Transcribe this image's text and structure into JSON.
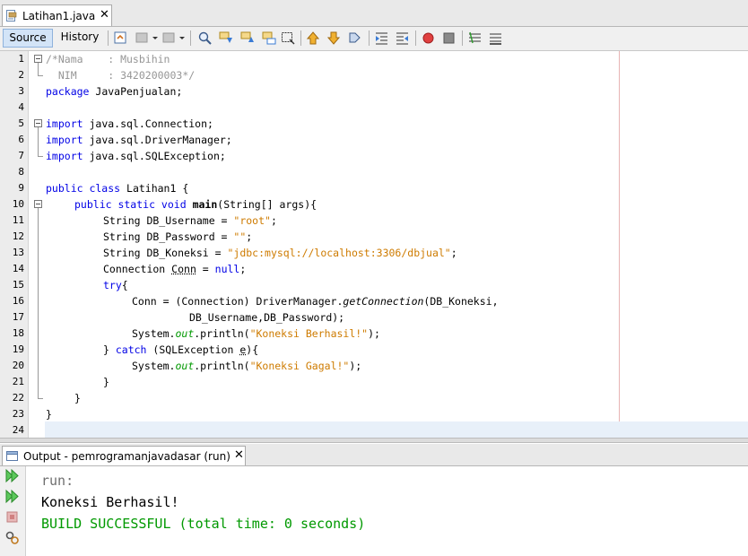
{
  "editor_tab": {
    "title": "Latihan1.java",
    "close": "✕"
  },
  "toolbar": {
    "source": "Source",
    "history": "History"
  },
  "line_numbers": [
    "1",
    "2",
    "3",
    "4",
    "5",
    "6",
    "7",
    "8",
    "9",
    "10",
    "11",
    "12",
    "13",
    "14",
    "15",
    "16",
    "17",
    "18",
    "19",
    "20",
    "21",
    "22",
    "23",
    "24"
  ],
  "code": {
    "l1": "/*Nama    : Musbihin",
    "l2": "  NIM     : 3420200003*/",
    "l3_kw": "package",
    "l3_rest": " JavaPenjualan;",
    "l5_kw": "import",
    "l5_rest": " java.sql.Connection;",
    "l6_kw": "import",
    "l6_rest": " java.sql.DriverManager;",
    "l7_kw": "import",
    "l7_rest": " java.sql.SQLException;",
    "l9_kw": "public class",
    "l9_name": " Latihan1",
    "l9_rest": " {",
    "l10_kw": "public static void",
    "l10_name": "main",
    "l10_rest": "(String[] args){",
    "l11_a": "String DB_Username = ",
    "l11_s": "\"root\"",
    "l11_b": ";",
    "l12_a": "String DB_Password = ",
    "l12_s": "\"\"",
    "l12_b": ";",
    "l13_a": "String DB_Koneksi = ",
    "l13_s": "\"jdbc:mysql://localhost:3306/dbjual\"",
    "l13_b": ";",
    "l14_a": "Connection ",
    "l14_u": "Conn",
    "l14_b": " = ",
    "l14_kw": "null",
    "l14_c": ";",
    "l15_kw": "try",
    "l15_b": "{",
    "l16_a": "Conn = (Connection) DriverManager.",
    "l16_i": "getConnection",
    "l16_b": "(DB_Koneksi,",
    "l17": "DB_Username,DB_Password);",
    "l18_a": "System.",
    "l18_f": "out",
    "l18_b": ".println(",
    "l18_s": "\"Koneksi Berhasil!\"",
    "l18_c": ");",
    "l19_a": "} ",
    "l19_kw": "catch",
    "l19_b": " (SQLException ",
    "l19_u": "e",
    "l19_c": "){",
    "l20_a": "System.",
    "l20_f": "out",
    "l20_b": ".println(",
    "l20_s": "\"Koneksi Gagal!\"",
    "l20_c": ");",
    "l21": "}",
    "l22": "}",
    "l23": "}"
  },
  "output_tab": {
    "title": "Output - pemrogramanjavadasar (run)",
    "close": "✕"
  },
  "output": {
    "run": "run:",
    "msg": "Koneksi Berhasil!",
    "build": "BUILD SUCCESSFUL (total time: 0 seconds)"
  },
  "colors": {
    "keyword": "#0000e6",
    "string": "#ce7b00",
    "comment": "#969696",
    "success": "#009900"
  }
}
